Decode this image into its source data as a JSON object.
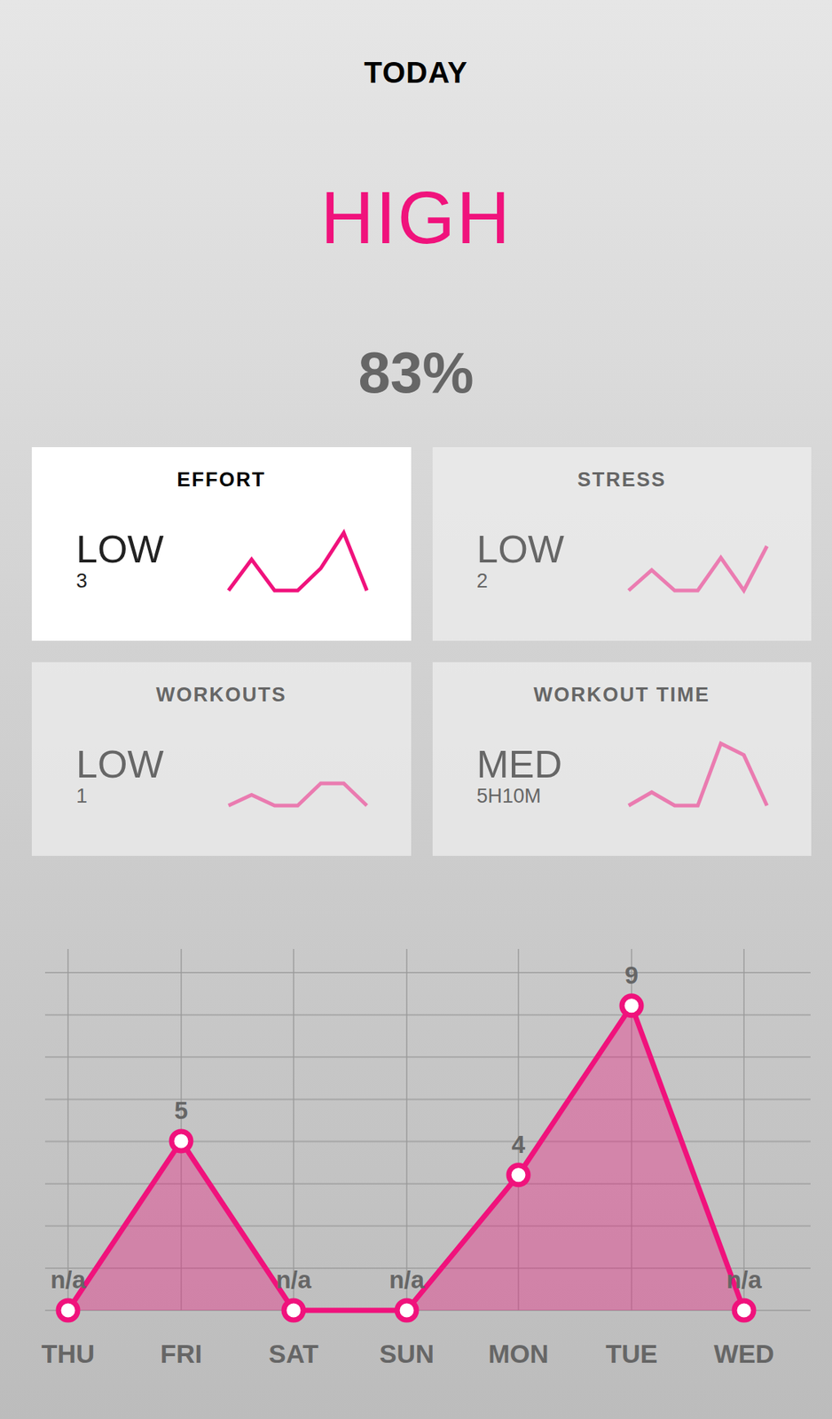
{
  "header": {
    "title": "TODAY",
    "level_label": "HIGH",
    "percent": "83%"
  },
  "tiles": [
    {
      "title": "EFFORT",
      "level": "LOW",
      "value": "3",
      "selected": true,
      "trend": [
        0,
        3.5,
        0,
        0,
        2.5,
        6.5,
        0
      ]
    },
    {
      "title": "STRESS",
      "level": "LOW",
      "value": "2",
      "selected": false,
      "trend": [
        0,
        2.3,
        0,
        0,
        3.7,
        0,
        5
      ]
    },
    {
      "title": "WORKOUTS",
      "level": "LOW",
      "value": "1",
      "selected": false,
      "trend": [
        0,
        1.2,
        0,
        0,
        2.5,
        2.5,
        0
      ]
    },
    {
      "title": "WORKOUT TIME",
      "level": "MED",
      "value": "5H10M",
      "selected": false,
      "trend": [
        0,
        1.5,
        0,
        0,
        7,
        5.7,
        0
      ]
    }
  ],
  "chart": {
    "points": [
      {
        "day": "THU",
        "label": "n/a",
        "value": 0
      },
      {
        "day": "FRI",
        "label": "5",
        "value": 5
      },
      {
        "day": "SAT",
        "label": "n/a",
        "value": 0
      },
      {
        "day": "SUN",
        "label": "n/a",
        "value": 0
      },
      {
        "day": "MON",
        "label": "4",
        "value": 4
      },
      {
        "day": "TUE",
        "label": "9",
        "value": 9
      },
      {
        "day": "WED",
        "label": "n/a",
        "value": 0
      }
    ]
  }
}
